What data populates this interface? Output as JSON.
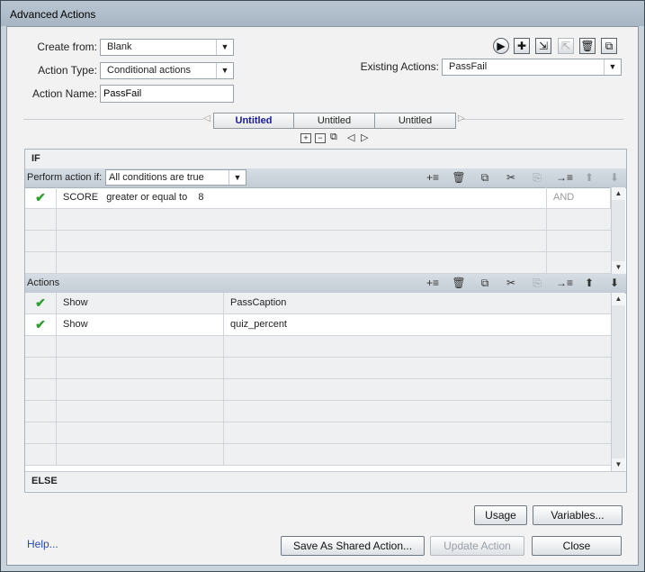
{
  "window": {
    "title": "Advanced Actions"
  },
  "form": {
    "create_from_label": "Create from:",
    "create_from_value": "Blank",
    "action_type_label": "Action Type:",
    "action_type_value": "Conditional actions",
    "action_name_label": "Action Name:",
    "action_name_value": "PassFail",
    "existing_actions_label": "Existing Actions:",
    "existing_actions_value": "PassFail"
  },
  "top_toolbar_icons": [
    "preview-icon",
    "add-icon",
    "import-icon",
    "export-icon",
    "delete-icon",
    "duplicate-icon"
  ],
  "tabs": [
    {
      "label": "Untitled",
      "active": true
    },
    {
      "label": "Untitled",
      "active": false
    },
    {
      "label": "Untitled",
      "active": false
    }
  ],
  "if_section": {
    "header": "IF",
    "perform_label": "Perform action if:",
    "perform_value": "All conditions are true",
    "conditions": [
      {
        "variable": "SCORE",
        "operator": "greater or equal to",
        "value": "8",
        "logic": "AND"
      }
    ]
  },
  "actions_section": {
    "header": "Actions",
    "rows": [
      {
        "action": "Show",
        "target": "PassCaption"
      },
      {
        "action": "Show",
        "target": "quiz_percent"
      }
    ]
  },
  "else_section": {
    "header": "ELSE"
  },
  "buttons": {
    "usage": "Usage",
    "variables": "Variables...",
    "save_shared": "Save As Shared Action...",
    "update": "Update Action",
    "close": "Close",
    "help": "Help..."
  }
}
